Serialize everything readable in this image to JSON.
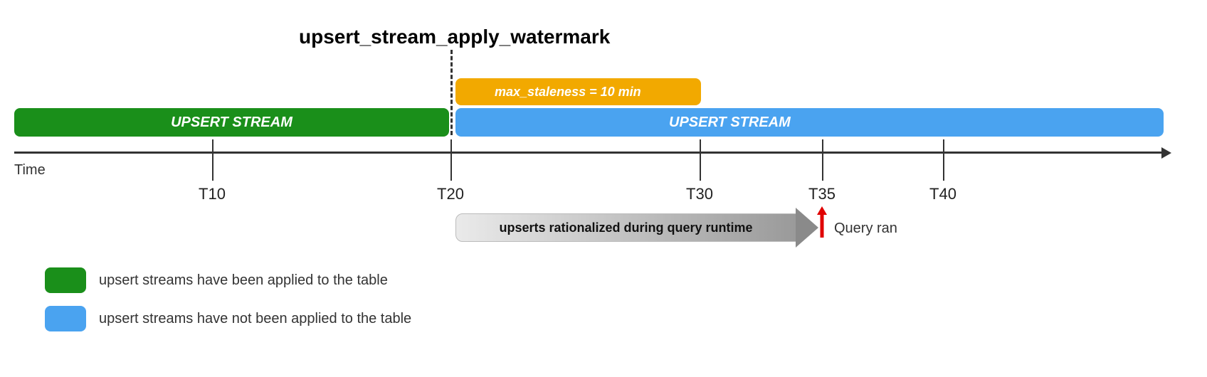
{
  "title": "upsert_stream_apply_watermark",
  "staleness_label": "max_staleness = 10 min",
  "streams": {
    "green_label": "UPSERT STREAM",
    "blue_label": "UPSERT STREAM"
  },
  "axis_label": "Time",
  "ticks": [
    {
      "pos": 298,
      "label": "T10"
    },
    {
      "pos": 633,
      "label": "T20"
    },
    {
      "pos": 983,
      "label": "T30"
    },
    {
      "pos": 1155,
      "label": "T35"
    },
    {
      "pos": 1325,
      "label": "T40"
    }
  ],
  "rationalized_label": "upserts rationalized during query runtime",
  "query_ran_label": "Query ran",
  "legend": {
    "green": "upsert streams have been applied to the table",
    "blue": "upsert streams have not been applied to the table"
  },
  "colors": {
    "green": "#1a8f1a",
    "blue": "#4aa3f0",
    "orange": "#f2a900",
    "red": "#e00000"
  },
  "chart_data": {
    "type": "timeline",
    "time_unit": "minutes",
    "axis_range": [
      0,
      45
    ],
    "watermark_at": 20,
    "max_staleness_minutes": 10,
    "staleness_window": [
      20,
      30
    ],
    "query_ran_at": 35,
    "rationalized_window": [
      20,
      35
    ],
    "segments": [
      {
        "name": "applied_upsert_stream",
        "from": 0,
        "to": 20,
        "color": "#1a8f1a"
      },
      {
        "name": "not_applied_upsert_stream",
        "from": 20,
        "to": 45,
        "color": "#4aa3f0"
      }
    ],
    "tick_marks": [
      10,
      20,
      30,
      35,
      40
    ],
    "title": "upsert_stream_apply_watermark",
    "xlabel": "Time"
  }
}
